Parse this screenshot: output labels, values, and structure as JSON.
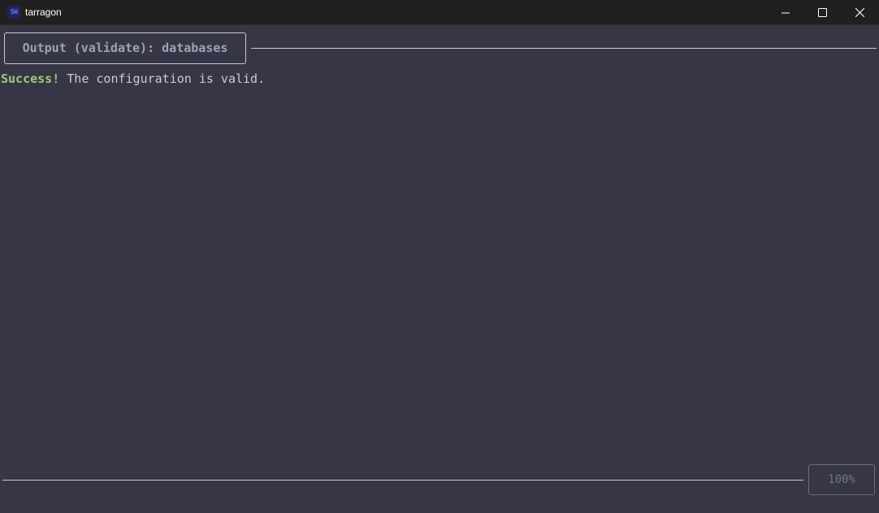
{
  "window": {
    "title": "tarragon",
    "icon": "sw-app-icon",
    "controls": {
      "minimize": "minimize-icon",
      "maximize": "maximize-icon",
      "close": "close-icon"
    }
  },
  "output": {
    "header": "Output (validate): databases",
    "status": "Success!",
    "message": " The configuration is valid.",
    "progress": "100%"
  },
  "colors": {
    "background": "#373646",
    "success": "#9ec77d",
    "header_text": "#9aa4b8",
    "border": "#c9c9d2"
  }
}
